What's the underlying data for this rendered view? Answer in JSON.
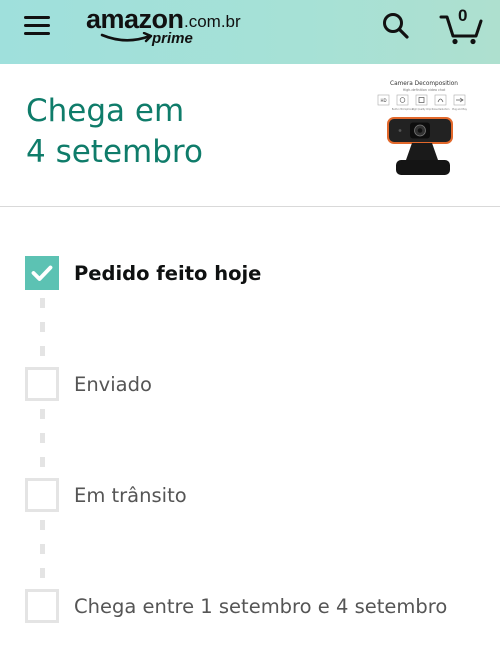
{
  "header": {
    "logo_main": "amazon",
    "logo_domain": ".com.br",
    "logo_sub": "prime",
    "cart_count": "0",
    "icons": [
      "menu-icon",
      "search-icon",
      "cart-icon"
    ],
    "bg_color": "#a3e0d8"
  },
  "delivery": {
    "title_line1": "Chega em",
    "title_line2": "4 setembro",
    "accent_color": "#0f7c6a"
  },
  "product": {
    "image_caption": "Camera Decomposition",
    "image_subcaption": "High-definition video chat",
    "feature_tags": [
      "HD",
      "Built-in Microphone",
      "High Quality Chip",
      "Noise Reduction",
      "Plug and Play"
    ]
  },
  "tracking": {
    "check_color": "#5cc2b3",
    "steps": [
      {
        "label": "Pedido feito hoje",
        "status": "done"
      },
      {
        "label": "Enviado",
        "status": "pending"
      },
      {
        "label": "Em trânsito",
        "status": "pending"
      },
      {
        "label": "Chega entre 1 setembro e 4 setembro",
        "status": "pending"
      }
    ]
  }
}
